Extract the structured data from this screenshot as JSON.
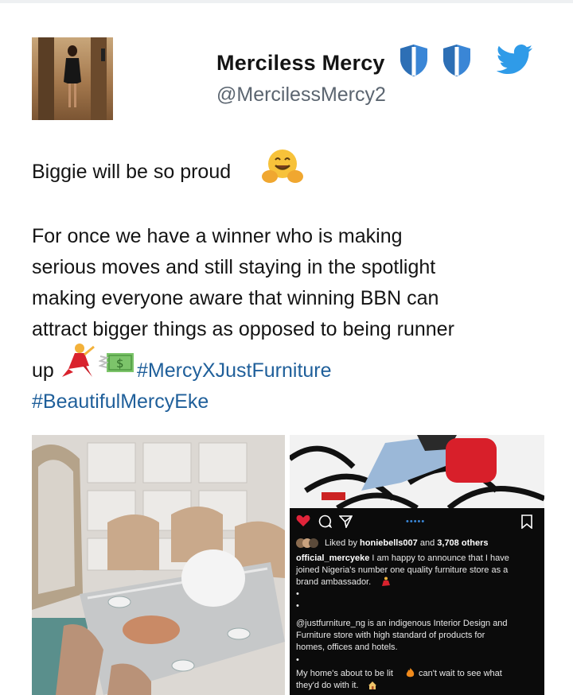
{
  "header": {
    "display_name": "Merciless  Mercy",
    "handle": "@MercilessMercy2",
    "badge_icons": [
      "shield-blue",
      "shield-blue"
    ],
    "platform_icon": "twitter-bird",
    "colors": {
      "shield": "#3a86d6",
      "twitter": "#2f9be8"
    }
  },
  "tweet": {
    "line1": "Biggie will be so proud",
    "line1_emoji": "hugging-face",
    "line2": "For once we have a winner who is making",
    "line3": "serious moves and still staying in the spotlight",
    "line4": "making everyone aware that winning BBN can",
    "line5": "attract bigger things as opposed to being runner",
    "line6_text": "up",
    "line6_emojis": [
      "dancer",
      "money-with-wings"
    ],
    "hashtag1": "#MercyXJustFurniture",
    "hashtag2": "#BeautifulMercyEke",
    "hashtag_color": "#1f5f9a"
  },
  "media": {
    "left_image": "dining-room-photo",
    "right_image": {
      "photo": "woman-on-zebra-couch",
      "dots": "•••••",
      "likes_prefix": "Liked by ",
      "likes_user": "honiebells007",
      "likes_mid": " and ",
      "likes_count": "3,708 others",
      "caption_user": "official_mercyeke",
      "caption_l1": " I am happy to announce that I have",
      "caption_l2": "joined Nigeria's number one quality furniture store as a",
      "caption_l3": "brand ambassador.",
      "bullet": "•",
      "para2_l1": "@justfurniture_ng is an indigenous Interior Design and",
      "para2_l2": "Furniture store with high standard of products for",
      "para2_l3": "homes, offices and hotels.",
      "para3_l1": "My home's about to be lit",
      "para3_l1b": "can't wait to see what",
      "para3_l2": "they'd do with it."
    }
  }
}
